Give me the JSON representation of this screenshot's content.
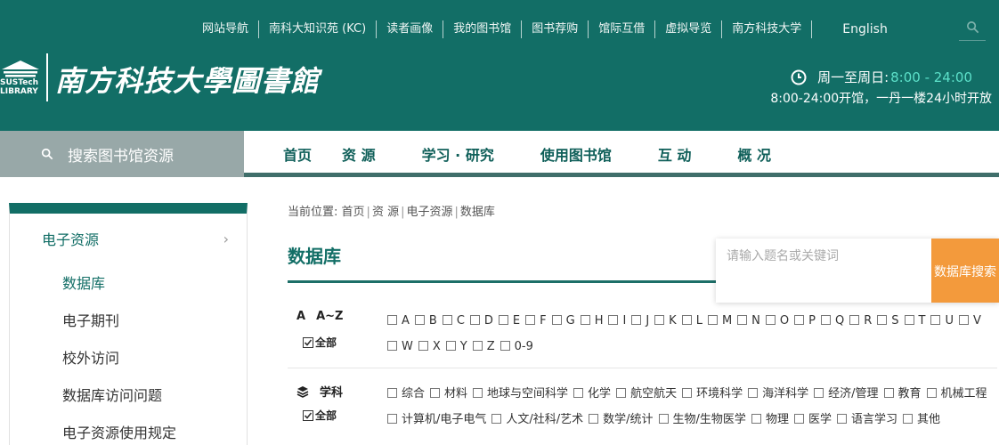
{
  "topnav": {
    "items": [
      "网站导航",
      "南科大知识苑 (KC)",
      "读者画像",
      "我的图书馆",
      "图书荐购",
      "馆际互借",
      "虚拟导览",
      "南方科技大学"
    ],
    "lang": "English"
  },
  "logo": {
    "abbr": "SUSTech",
    "lib": "LIBRARY",
    "cn": "南方科技大學圖書館"
  },
  "hours": {
    "days": "周一至周日:",
    "time": "8:00 - 24:00",
    "note": "8:00-24:00开馆，一丹一楼24小时开放"
  },
  "search_library": "搜索图书馆资源",
  "mainnav": [
    "首页",
    "资 源",
    "学习 · 研究",
    "使用图书馆",
    "互 动",
    "概 况"
  ],
  "sidebar": {
    "head": "电子资源",
    "items": [
      "数据库",
      "电子期刊",
      "校外访问",
      "数据库访问问题",
      "电子资源使用规定"
    ]
  },
  "breadcrumb": {
    "prefix": "当前位置:",
    "parts": [
      "首页",
      "资 源",
      "电子资源",
      "数据库"
    ]
  },
  "page_title": "数据库",
  "db_search": {
    "placeholder": "请输入题名或关键词",
    "button": "数据库搜索"
  },
  "az_filter": {
    "icon_text": "A",
    "label": "A~Z",
    "all": "全部",
    "options": [
      "A",
      "B",
      "C",
      "D",
      "E",
      "F",
      "G",
      "H",
      "I",
      "J",
      "K",
      "L",
      "M",
      "N",
      "O",
      "P",
      "Q",
      "R",
      "S",
      "T",
      "U",
      "V",
      "W",
      "X",
      "Y",
      "Z",
      "0-9"
    ]
  },
  "subject_filter": {
    "label": "学科",
    "all": "全部",
    "options": [
      "综合",
      "材料",
      "地球与空间科学",
      "化学",
      "航空航天",
      "环境科学",
      "海洋科学",
      "经济/管理",
      "教育",
      "机械工程",
      "计算机/电子电气",
      "人文/社科/艺术",
      "数学/统计",
      "生物/生物医学",
      "物理",
      "医学",
      "语言学习",
      "其他"
    ]
  },
  "colors": {
    "brand": "#126e66",
    "accent_orange": "#f39a3c",
    "time_green": "#5ce0c9"
  }
}
